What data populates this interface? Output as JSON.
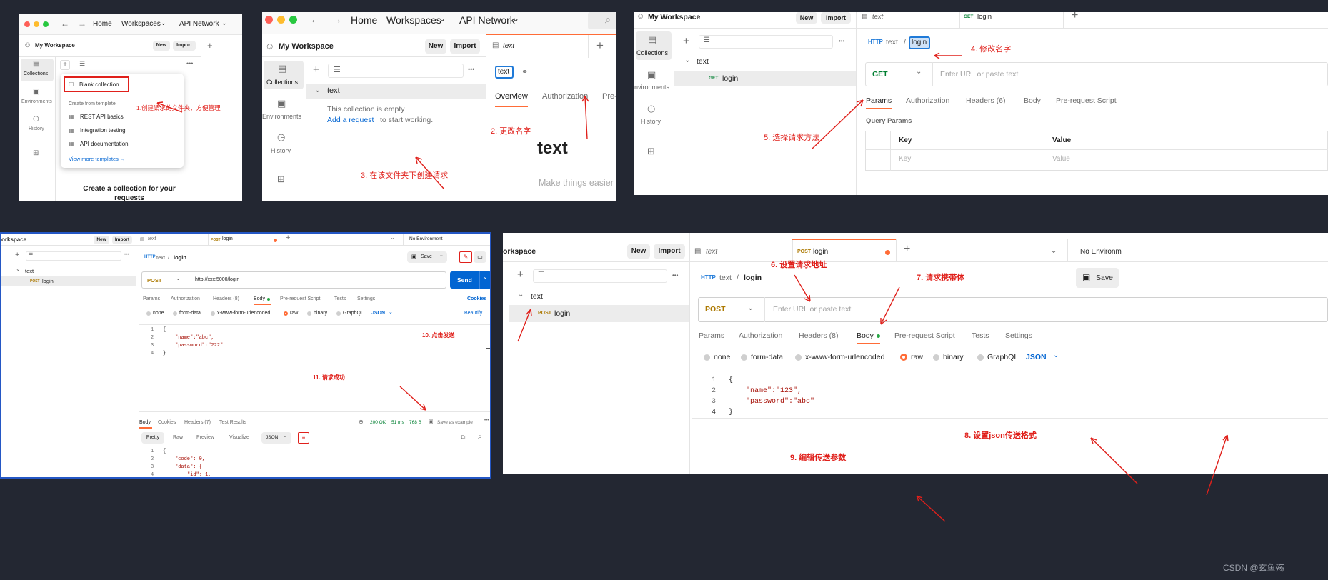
{
  "panel1": {
    "nav": {
      "home": "Home",
      "workspaces": "Workspaces",
      "api_network": "API Network"
    },
    "workspace": "My Workspace",
    "new_btn": "New",
    "import_btn": "Import",
    "side": {
      "collections": "Collections",
      "environments": "Environments",
      "history": "History"
    },
    "menu": {
      "blank": "Blank collection",
      "from_template": "Create from template",
      "templates": [
        "REST API basics",
        "Integration testing",
        "API documentation"
      ],
      "view_more": "View more templates →"
    },
    "create_text": "Create a collection for your requests",
    "annotation": "1.创建请求的文件夹，方便管理"
  },
  "panel2": {
    "nav": {
      "home": "Home",
      "workspaces": "Workspaces",
      "api_network": "API Network"
    },
    "workspace": "My Workspace",
    "new_btn": "New",
    "import_btn": "Import",
    "side": {
      "collections": "Collections",
      "environments": "Environments",
      "history": "History"
    },
    "folder": "text",
    "empty": "This collection is empty",
    "add_request": "Add a request",
    "to_start": "to start working.",
    "tab_title": "text",
    "name_box": "text",
    "tabs": [
      "Overview",
      "Authorization",
      "Pre-"
    ],
    "big_title": "text",
    "tagline": "Make things easier",
    "annotation_rename": "2. 更改名字",
    "annotation_create": "3. 在该文件夹下创建请求"
  },
  "panel3": {
    "workspace": "My Workspace",
    "new_btn": "New",
    "import_btn": "Import",
    "side": {
      "collections": "Collections",
      "environments": "Environments",
      "history": "History"
    },
    "folder": "text",
    "req_method": "GET",
    "req_name": "login",
    "tab1": "text",
    "tab2_method": "GET",
    "tab2": "login",
    "crumb_parent": "text",
    "crumb_sep": "/",
    "crumb_name": "login",
    "method": "GET",
    "url_placeholder": "Enter URL or paste text",
    "tabs": [
      "Params",
      "Authorization",
      "Headers (6)",
      "Body",
      "Pre-request Script"
    ],
    "query_params": "Query Params",
    "col_key": "Key",
    "col_value": "Value",
    "ph_key": "Key",
    "ph_value": "Value",
    "annotation_rename": "4. 修改名字",
    "annotation_method": "5. 选择请求方法"
  },
  "panel4": {
    "workspace": "orkspace",
    "new_btn": "New",
    "import_btn": "Import",
    "folder": "text",
    "req_method": "POST",
    "req_name": "login",
    "tab1": "text",
    "tab2_method": "POST",
    "tab2": "login",
    "env": "No Environment",
    "crumb_parent": "text",
    "crumb_sep": "/",
    "crumb_name": "login",
    "save": "Save",
    "method": "POST",
    "url": "http://xxx:5000/login",
    "send": "Send",
    "tabs": [
      "Params",
      "Authorization",
      "Headers (8)",
      "Body",
      "Pre-request Script",
      "Tests",
      "Settings"
    ],
    "cookies": "Cookies",
    "body_types": [
      "none",
      "form-data",
      "x-www-form-urlencoded",
      "raw",
      "binary",
      "GraphQL"
    ],
    "json": "JSON",
    "beautify": "Beautify",
    "code_lines": [
      "{",
      "\"name\":\"abc\",",
      "\"password\":\"222\"",
      "}"
    ],
    "resp_tabs": [
      "Body",
      "Cookies",
      "Headers (7)",
      "Test Results"
    ],
    "status": "200 OK",
    "time": "51 ms",
    "size": "768 B",
    "save_example": "Save as example",
    "view_tabs": [
      "Pretty",
      "Raw",
      "Preview",
      "Visualize"
    ],
    "resp_json": "JSON",
    "resp_lines": [
      "{",
      "\"code\": 0,",
      "\"data\": {",
      "\"id\": 1,"
    ],
    "annotation_send": "10. 点击发送",
    "annotation_success": "11. 请求成功"
  },
  "panel5": {
    "workspace": "orkspace",
    "new_btn": "New",
    "import_btn": "Import",
    "folder": "text",
    "req_method": "POST",
    "req_name": "login",
    "tab1": "text",
    "tab2_method": "POST",
    "tab2": "login",
    "env": "No Environm",
    "crumb_parent": "text",
    "crumb_sep": "/",
    "crumb_name": "login",
    "save": "Save",
    "method": "POST",
    "url_placeholder": "Enter URL or paste text",
    "tabs": [
      "Params",
      "Authorization",
      "Headers (8)",
      "Body",
      "Pre-request Script",
      "Tests",
      "Settings"
    ],
    "body_types": [
      "none",
      "form-data",
      "x-www-form-urlencoded",
      "raw",
      "binary",
      "GraphQL"
    ],
    "json": "JSON",
    "code_lines": [
      "{",
      "\"name\":\"123\",",
      "\"password\":\"abc\"",
      "}"
    ],
    "annotation_url": "6. 设置请求地址",
    "annotation_body": "7. 请求携带体",
    "annotation_json": "8. 设置json传送格式",
    "annotation_params": "9. 编辑传送参数"
  },
  "watermark": "CSDN @玄鱼殇",
  "colors": {
    "accent": "#ff6c37",
    "annotation": "#e0201b",
    "link": "#0265d2",
    "get": "#007f31",
    "post": "#ad7a03"
  }
}
